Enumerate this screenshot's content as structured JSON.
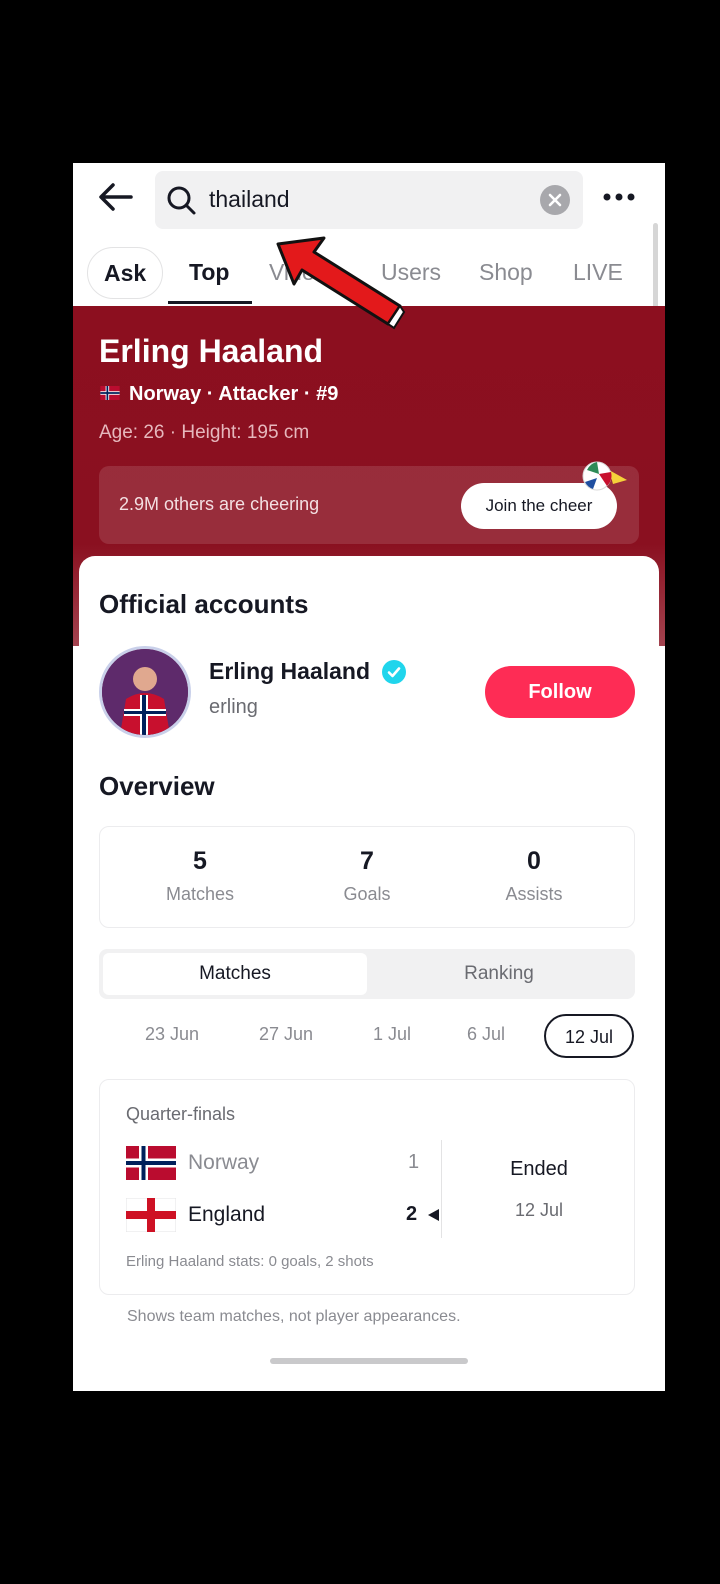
{
  "search": {
    "query": "thailand"
  },
  "tabs": [
    {
      "label": "Ask"
    },
    {
      "label": "Top"
    },
    {
      "label": "Videos"
    },
    {
      "label": "Users"
    },
    {
      "label": "Shop"
    },
    {
      "label": "LIVE"
    }
  ],
  "player": {
    "name": "Erling Haaland",
    "info": "Norway · Attacker · #9",
    "meta": "Age: 26 · Height: 195 cm",
    "cheer_text": "2.9M others are cheering",
    "cheer_button": "Join the cheer"
  },
  "official": {
    "title": "Official accounts",
    "account_name": "Erling Haaland",
    "handle": "erling",
    "follow_label": "Follow"
  },
  "overview": {
    "title": "Overview",
    "stats": [
      {
        "value": "5",
        "label": "Matches"
      },
      {
        "value": "7",
        "label": "Goals"
      },
      {
        "value": "0",
        "label": "Assists"
      }
    ],
    "segments": [
      "Matches",
      "Ranking"
    ],
    "dates": [
      "23 Jun",
      "27 Jun",
      "1 Jul",
      "6 Jul",
      "12 Jul"
    ],
    "selected_date": "12 Jul"
  },
  "match": {
    "stage": "Quarter-finals",
    "home_team": "Norway",
    "home_score": "1",
    "away_team": "England",
    "away_score": "2",
    "status": "Ended",
    "date": "12 Jul",
    "note": "Erling Haaland stats: 0 goals, 2 shots"
  },
  "footnote": "Shows team matches, not player appearances.",
  "colors": {
    "banner": "#8c0f1f",
    "follow": "#fe2c55",
    "verified": "#20d5ec",
    "annotation": "#e3191b"
  }
}
